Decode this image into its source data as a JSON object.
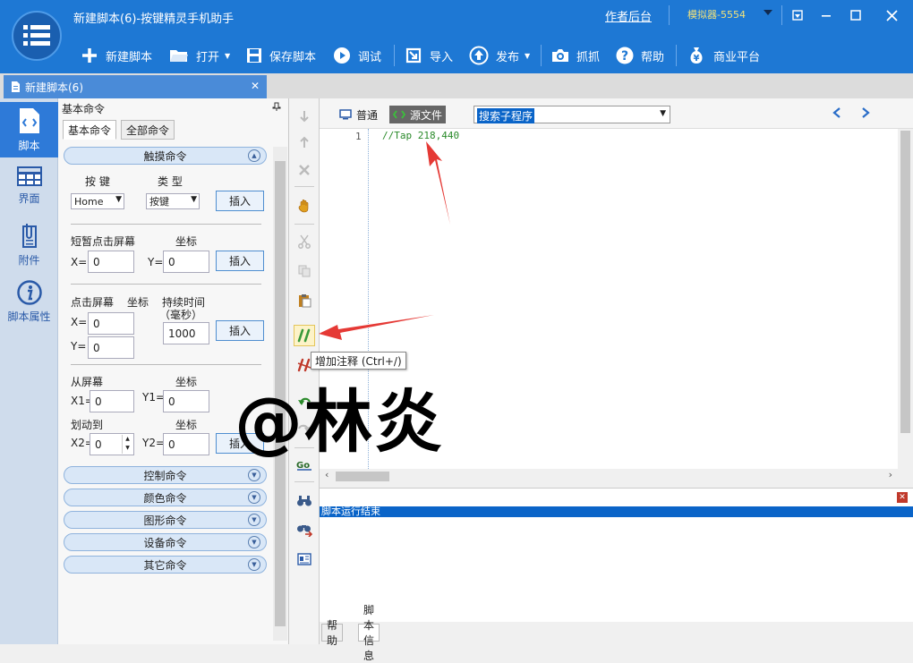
{
  "window": {
    "title": "新建脚本(6)-按键精灵手机助手",
    "author_link": "作者后台",
    "device": "模拟器-5554"
  },
  "toolbar": {
    "new_script": "新建脚本",
    "open": "打开",
    "save_script": "保存脚本",
    "debug": "调试",
    "import": "导入",
    "publish": "发布",
    "capture": "抓抓",
    "help": "帮助",
    "business": "商业平台"
  },
  "doc_tab": {
    "label": "新建脚本(6)"
  },
  "rail": {
    "items": [
      {
        "label": "脚本",
        "icon": "script-file-icon"
      },
      {
        "label": "界面",
        "icon": "ui-grid-icon"
      },
      {
        "label": "附件",
        "icon": "attachment-icon"
      },
      {
        "label": "脚本属性",
        "icon": "info-icon"
      }
    ]
  },
  "panel": {
    "title": "基本命令",
    "tabs": [
      "基本命令",
      "全部命令"
    ],
    "touch": {
      "header": "触摸命令",
      "key_label": "按 键",
      "type_label": "类 型",
      "key_value": "Home",
      "type_value": "按键",
      "insert": "插入"
    },
    "tap": {
      "title": "短暂点击屏幕",
      "coord_label": "坐标",
      "x_label": "X=",
      "y_label": "Y=",
      "x_value": "0",
      "y_value": "0",
      "insert": "插入"
    },
    "press": {
      "title": "点击屏幕",
      "coord_label": "坐标",
      "duration_label": "持续时间",
      "duration_unit": "（毫秒）",
      "x_label": "X=",
      "y_label": "Y=",
      "x_value": "0",
      "y_value": "0",
      "duration_value": "1000",
      "insert": "插入"
    },
    "swipe": {
      "from_label": "从屏幕",
      "coord_label1": "坐标",
      "to_label": "划动到",
      "coord_label2": "坐标",
      "x1_label": "X1=",
      "y1_label": "Y1=",
      "x2_label": "X2=",
      "y2_label": "Y2=",
      "x1_value": "0",
      "y1_value": "0",
      "x2_value": "0",
      "y2_value": "0",
      "insert": "插入"
    },
    "groups": [
      "控制命令",
      "颜色命令",
      "图形命令",
      "设备命令",
      "其它命令"
    ]
  },
  "editor": {
    "mode_normal": "普通",
    "mode_source": "源文件",
    "sub_select": "搜索子程序",
    "line_number": "1",
    "code": "//Tap 218,440"
  },
  "tooltip": "增加注释 (Ctrl+/)",
  "output": {
    "status": "脚本运行结束",
    "tabs": [
      "帮助",
      "脚本信息"
    ]
  },
  "watermark": "@林炎",
  "colors": {
    "title_bar": "#1e78d4",
    "accent": "#2e7ad8",
    "annotation_arrow": "#e53935"
  }
}
